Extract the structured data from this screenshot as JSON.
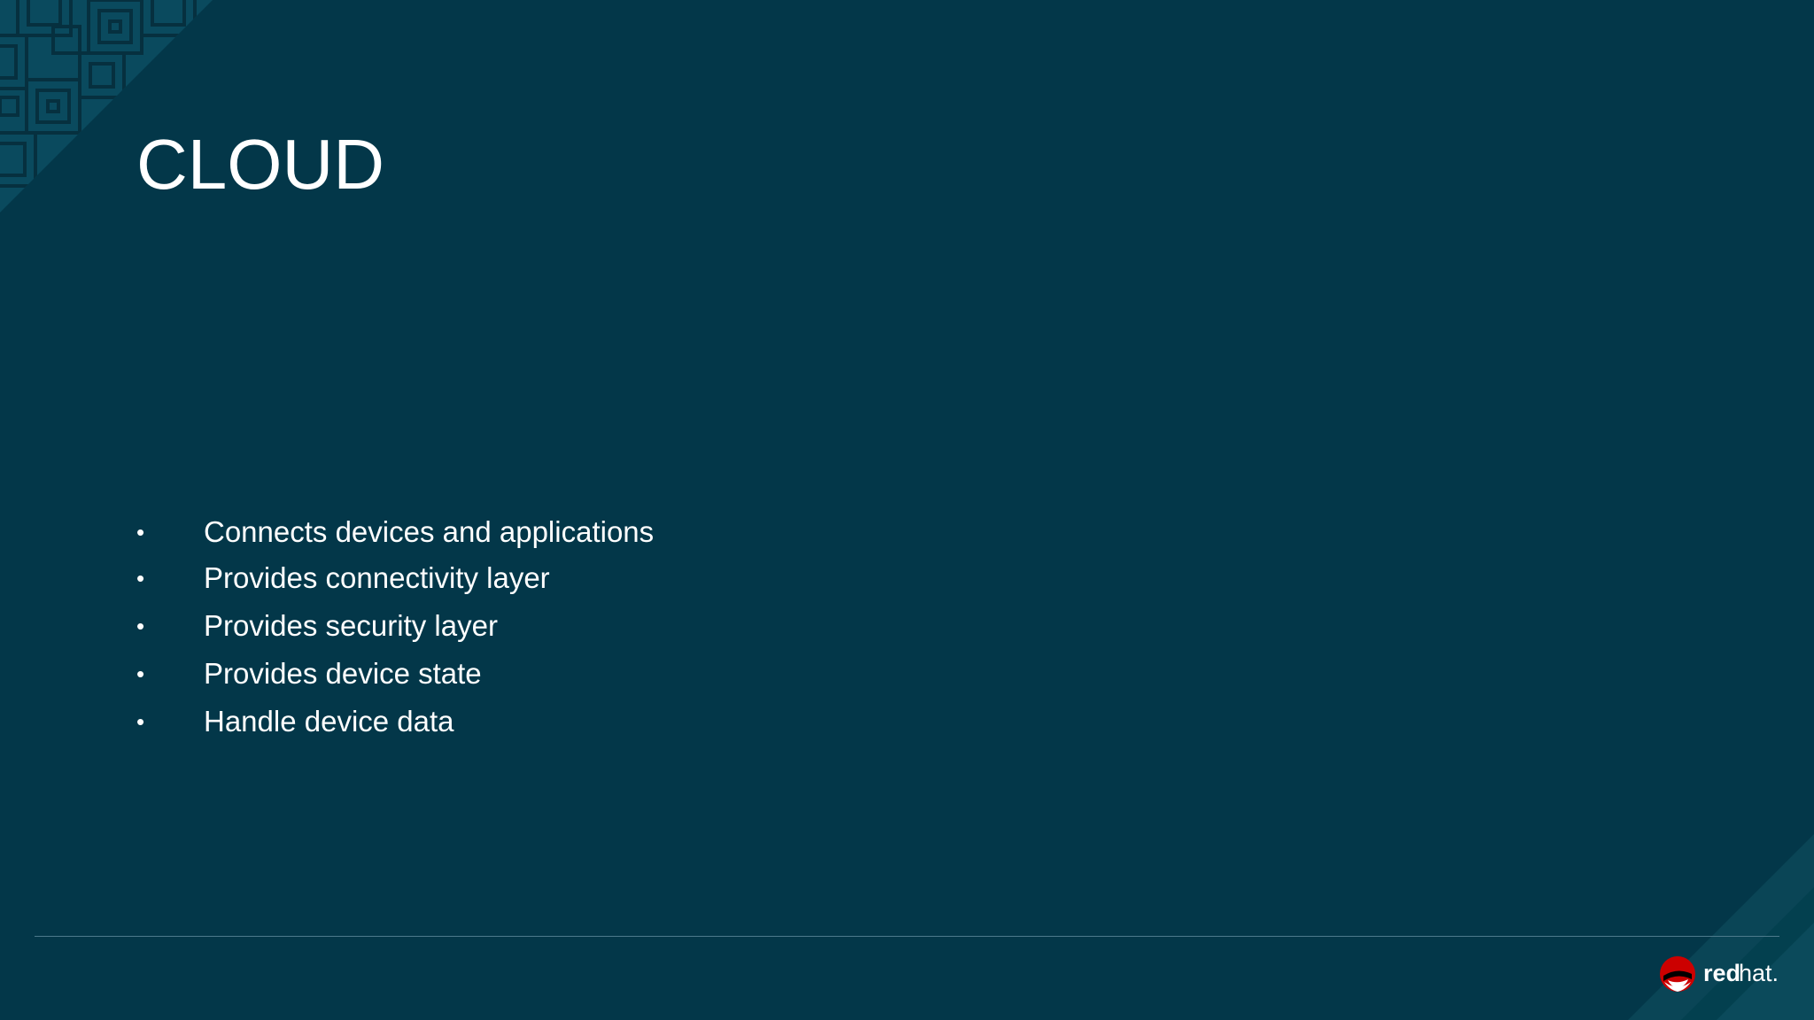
{
  "slide": {
    "title": "CLOUD",
    "bullets": [
      "Connects devices and applications",
      "Provides connectivity layer",
      "Provides security layer",
      "Provides device state",
      "Handle device data"
    ],
    "bullet_marker": "•"
  },
  "logo": {
    "text_bold": "red",
    "text_light": "hat.",
    "icon": "red-hat-shadowman-icon"
  },
  "colors": {
    "background": "#033749",
    "text": "#ffffff",
    "accent": "#cc0000",
    "rule": "#4d7a8b"
  }
}
